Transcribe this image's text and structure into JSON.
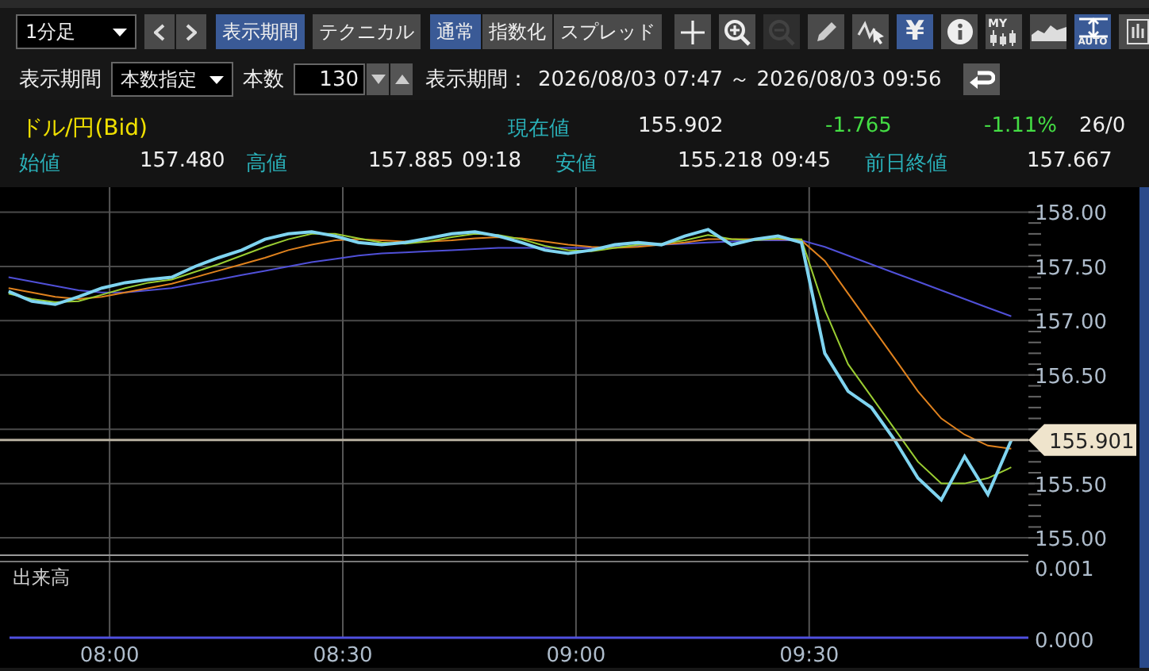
{
  "toolbar": {
    "interval": {
      "value": "1分足"
    },
    "nav": [
      {
        "kind": "prev"
      },
      {
        "kind": "next"
      }
    ],
    "view_tabs": [
      {
        "label": "表示期間",
        "selected": true
      },
      {
        "label": "テクニカル",
        "selected": false
      }
    ],
    "mode_tabs": [
      {
        "label": "通常",
        "selected": true
      },
      {
        "label": "指数化",
        "selected": false
      },
      {
        "label": "スプレッド",
        "selected": false
      }
    ],
    "tools": [
      {
        "kind": "crosshair",
        "selected": false,
        "disabled": false
      },
      {
        "kind": "zoom-in",
        "selected": false,
        "disabled": false
      },
      {
        "kind": "zoom-out",
        "selected": false,
        "disabled": true
      },
      {
        "kind": "pencil",
        "selected": false,
        "disabled": false
      },
      {
        "kind": "trend",
        "selected": false,
        "disabled": false
      },
      {
        "kind": "symbol",
        "symbol": "¥",
        "selected": true,
        "disabled": false
      },
      {
        "kind": "info",
        "selected": false,
        "disabled": false
      },
      {
        "kind": "my-candles",
        "symbol": "MY",
        "selected": false,
        "disabled": false
      },
      {
        "kind": "area",
        "selected": false,
        "disabled": false
      },
      {
        "kind": "auto-scale",
        "symbol": "AUTO",
        "selected": true,
        "disabled": false
      },
      {
        "kind": "bars",
        "selected": false,
        "disabled": false
      }
    ]
  },
  "period_bar": {
    "label": "表示期間",
    "mode": {
      "value": "本数指定"
    },
    "count_label": "本数",
    "count": {
      "value": "130"
    },
    "range_label": "表示期間：",
    "range": "2026/08/03 07:47 ～ 2026/08/03 09:56"
  },
  "quote": {
    "title": "ドル/円(Bid)",
    "current_label": "現在値",
    "current": "155.902",
    "change": "-1.765",
    "change_pct": "-1.11%",
    "date": "26/0",
    "stats": [
      {
        "label": "始値",
        "value": "157.480"
      },
      {
        "label": "高値",
        "value": "157.885",
        "time": "09:18"
      },
      {
        "label": "安値",
        "value": "155.218",
        "time": "09:45"
      },
      {
        "label": "前日終値",
        "value": "157.667"
      }
    ]
  },
  "chart": {
    "chart_data": {
      "type": "line",
      "x": [
        467,
        470,
        473,
        476,
        479,
        482,
        485,
        488,
        491,
        494,
        497,
        500,
        503,
        506,
        509,
        512,
        515,
        518,
        521,
        524,
        527,
        530,
        533,
        536,
        539,
        542,
        545,
        548,
        551,
        554,
        557,
        560,
        563,
        566,
        569,
        572,
        575,
        578,
        581,
        584,
        587,
        590,
        593,
        596
      ],
      "xlim": [
        465.9,
        598.2
      ],
      "ylim": [
        154.84,
        158.23
      ],
      "grid": true,
      "ref_lines": [
        {
          "axis": "y",
          "value": 155.901,
          "label": "155.901"
        }
      ],
      "series": [
        {
          "color": "#7fd4f0",
          "values": [
            157.27,
            157.18,
            157.15,
            157.22,
            157.3,
            157.35,
            157.38,
            157.4,
            157.5,
            157.58,
            157.65,
            157.75,
            157.8,
            157.82,
            157.78,
            157.72,
            157.7,
            157.72,
            157.76,
            157.8,
            157.82,
            157.78,
            157.72,
            157.65,
            157.62,
            157.65,
            157.7,
            157.72,
            157.7,
            157.78,
            157.84,
            157.7,
            157.75,
            157.78,
            157.72,
            156.7,
            156.35,
            156.2,
            155.9,
            155.55,
            155.35,
            155.75,
            155.4,
            155.9
          ]
        },
        {
          "color": "#9acd32",
          "values": [
            157.25,
            157.2,
            157.17,
            157.18,
            157.24,
            157.3,
            157.35,
            157.38,
            157.45,
            157.52,
            157.6,
            157.68,
            157.75,
            157.8,
            157.8,
            157.76,
            157.72,
            157.71,
            157.73,
            157.77,
            157.8,
            157.79,
            157.75,
            157.69,
            157.65,
            157.64,
            157.67,
            157.7,
            157.71,
            157.74,
            157.79,
            157.75,
            157.74,
            157.76,
            157.75,
            157.1,
            156.6,
            156.3,
            156.0,
            155.7,
            155.5,
            155.5,
            155.55,
            155.65
          ]
        },
        {
          "color": "#e0821e",
          "values": [
            157.3,
            157.26,
            157.22,
            157.2,
            157.22,
            157.26,
            157.3,
            157.34,
            157.4,
            157.46,
            157.52,
            157.58,
            157.65,
            157.7,
            157.74,
            157.75,
            157.74,
            157.73,
            157.73,
            157.74,
            157.76,
            157.77,
            157.76,
            157.73,
            157.7,
            157.68,
            157.67,
            157.68,
            157.7,
            157.72,
            157.75,
            157.75,
            157.75,
            157.75,
            157.74,
            157.55,
            157.25,
            156.95,
            156.65,
            156.35,
            156.1,
            155.95,
            155.85,
            155.82
          ]
        },
        {
          "color": "#5050d8",
          "values": [
            157.4,
            157.36,
            157.32,
            157.28,
            157.26,
            157.26,
            157.28,
            157.3,
            157.34,
            157.38,
            157.42,
            157.46,
            157.5,
            157.54,
            157.57,
            157.6,
            157.62,
            157.63,
            157.64,
            157.65,
            157.66,
            157.67,
            157.67,
            157.67,
            157.67,
            157.67,
            157.68,
            157.69,
            157.7,
            157.71,
            157.72,
            157.73,
            157.74,
            157.74,
            157.74,
            157.68,
            157.6,
            157.52,
            157.44,
            157.36,
            157.28,
            157.2,
            157.12,
            157.04
          ]
        }
      ],
      "xticks": [
        {
          "value": 480,
          "label": "08:00"
        },
        {
          "value": 510,
          "label": "08:30"
        },
        {
          "value": 540,
          "label": "09:00"
        },
        {
          "value": 570,
          "label": "09:30"
        }
      ],
      "yticks": [
        {
          "value": 155,
          "label": "155.00"
        },
        {
          "value": 155.5,
          "label": "155.50"
        },
        {
          "value": 156.5,
          "label": "156.50"
        },
        {
          "value": 157,
          "label": "157.00"
        },
        {
          "value": 157.5,
          "label": "157.50"
        },
        {
          "value": 158,
          "label": "158.00"
        }
      ]
    },
    "volume_pane": {
      "title": "出来高",
      "axis_labels": [
        "0.001",
        "0.000"
      ]
    }
  }
}
